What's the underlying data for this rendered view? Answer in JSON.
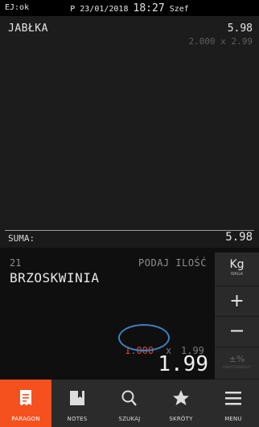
{
  "status": {
    "ej": "EJ:ok",
    "prefix": "P",
    "date": "23/01/2018",
    "time": "18:27",
    "user": "Szef"
  },
  "receipt": {
    "items": [
      {
        "name": "JABŁKA",
        "price": "5.98",
        "detail": "2.000 x 2.99"
      }
    ],
    "sum_label": "SUMA:",
    "sum_value": "5.98"
  },
  "entry": {
    "plu": "21",
    "prompt": "PODAJ ILOŚĆ",
    "name": "BRZOSKWINIA",
    "quantity": "1.000",
    "times": "x",
    "unit_price": "1.99",
    "total": "1.99"
  },
  "side_buttons": {
    "kg": {
      "label": "Kg",
      "sub": "WAGA"
    },
    "plus": "+",
    "minus": "−",
    "pct": {
      "label": "±%",
      "sub": "RABAT/NARZUT"
    }
  },
  "nav": [
    {
      "label": "PARAGON",
      "icon": "receipt-icon",
      "active": true
    },
    {
      "label": "NOTES",
      "icon": "notebook-icon",
      "active": false
    },
    {
      "label": "SZUKAJ",
      "icon": "search-icon",
      "active": false
    },
    {
      "label": "SKRÓTY",
      "icon": "star-icon",
      "active": false
    },
    {
      "label": "MENU",
      "icon": "menu-icon",
      "active": false
    }
  ],
  "colors": {
    "accent": "#f4511e",
    "quantity": "#e0442a",
    "annotation_ring": "#3b82c4"
  }
}
